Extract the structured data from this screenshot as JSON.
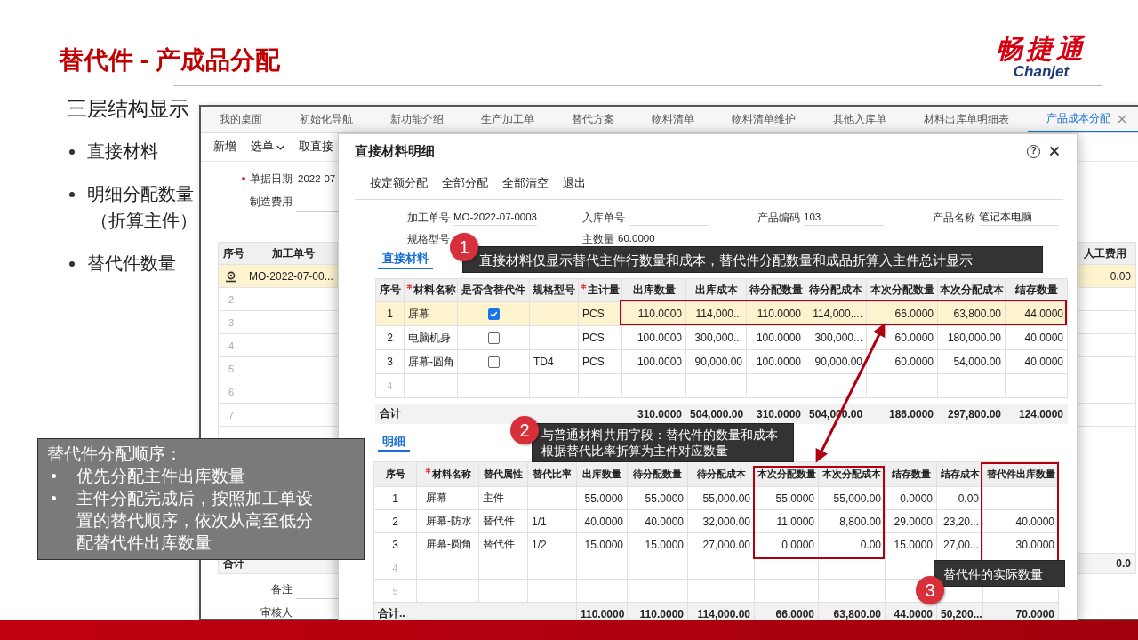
{
  "slide": {
    "title": "替代件 - 产成品分配",
    "logo": {
      "name": "畅捷通",
      "latin": "Chanjet"
    },
    "heading": "三层结构显示",
    "bullets": [
      {
        "lines": [
          "直接材料"
        ]
      },
      {
        "lines": [
          "明细分配数量",
          "（折算主件）"
        ]
      },
      {
        "lines": [
          "替代件数量"
        ]
      }
    ]
  },
  "app": {
    "tabs": [
      {
        "label": "我的桌面",
        "selected": false
      },
      {
        "label": "初始化导航",
        "selected": false
      },
      {
        "label": "新功能介绍",
        "selected": false
      },
      {
        "label": "生产加工单",
        "selected": false
      },
      {
        "label": "替代方案",
        "selected": false
      },
      {
        "label": "物料清单",
        "selected": false
      },
      {
        "label": "物料清单维护",
        "selected": false
      },
      {
        "label": "其他入库单",
        "selected": false
      },
      {
        "label": "材料出库单明细表",
        "selected": false
      },
      {
        "label": "产品成本分配",
        "selected": true
      }
    ],
    "toolbar": [
      {
        "label": "新增",
        "dropdown": false
      },
      {
        "label": "选单",
        "dropdown": true
      },
      {
        "label": "取直接",
        "dropdown": false
      }
    ],
    "form": [
      {
        "label": "单据日期",
        "required": true,
        "value": "2022-07"
      },
      {
        "label": "制造费用",
        "required": false
      }
    ],
    "table": {
      "columns": [
        "序号",
        "加工单号"
      ],
      "last_column": "人工费用",
      "rows": [
        {
          "kind": "current",
          "order": "MO-2022-07-00...",
          "labor": "0.00",
          "selected": true
        },
        {
          "kind": "blank",
          "index": "2",
          "selected": false
        },
        {
          "kind": "blank",
          "index": "3",
          "selected": false
        },
        {
          "kind": "blank",
          "index": "4",
          "selected": false
        },
        {
          "kind": "blank",
          "index": "5",
          "selected": false
        },
        {
          "kind": "blank",
          "index": "6",
          "selected": false
        },
        {
          "kind": "blank",
          "index": "7",
          "selected": false
        }
      ],
      "total": {
        "label": "合计",
        "labor": "0.0"
      }
    },
    "footer_fields": [
      "备注",
      "审核人"
    ]
  },
  "dialog": {
    "title": "直接材料明细",
    "help": "?",
    "toolbar": [
      "按定额分配",
      "全部分配",
      "全部清空",
      "退出"
    ],
    "fields": [
      {
        "label": "加工单号",
        "value": "MO-2022-07-0003"
      },
      {
        "label": "入库单号"
      },
      {
        "label": "产品编码",
        "value": "103"
      },
      {
        "label": "产品名称",
        "value": "笔记本电脑"
      },
      {
        "label": "规格型号"
      },
      {
        "label": "主数量",
        "value": "60.0000"
      }
    ],
    "direct": {
      "tab": {
        "label": "直接材料",
        "selected": true
      },
      "columns": [
        {
          "label": "序号",
          "required": false
        },
        {
          "label": "材料名称",
          "required": true
        },
        {
          "label": "是否含替代件",
          "required": false
        },
        {
          "label": "规格型号",
          "required": false
        },
        {
          "label": "主计量",
          "required": true
        },
        {
          "label": "出库数量",
          "required": false
        },
        {
          "label": "出库成本",
          "required": false
        },
        {
          "label": "待分配数量",
          "required": false
        },
        {
          "label": "待分配成本",
          "required": false
        },
        {
          "label": "本次分配数量",
          "required": false
        },
        {
          "label": "本次分配成本",
          "required": false
        },
        {
          "label": "结存数量",
          "required": false
        }
      ],
      "rows": [
        {
          "index": "1",
          "name": "屏幕",
          "substitute": true,
          "unit": "PCS",
          "cells": [
            "110.0000",
            "114,000...",
            "110.0000",
            "114,000....",
            "66.0000",
            "63,800.00",
            "44.0000"
          ],
          "selected": true
        },
        {
          "index": "2",
          "name": "电脑机身",
          "substitute": false,
          "unit": "PCS",
          "cells": [
            "100.0000",
            "300,000...",
            "100.0000",
            "300,000...",
            "60.0000",
            "180,000.00",
            "40.0000"
          ],
          "selected": false
        },
        {
          "index": "3",
          "name": "屏幕-圆角",
          "substitute": false,
          "spec": "TD4",
          "unit": "PCS",
          "cells": [
            "100.0000",
            "90,000.00",
            "100.0000",
            "90,000.00",
            "60.0000",
            "54,000.00",
            "40.0000"
          ],
          "selected": false
        },
        {
          "index": "4",
          "selected": false
        }
      ],
      "total": {
        "label": "合计",
        "values": [
          "310.0000",
          "504,000.00",
          "310.0000",
          "504,000.00",
          "186.0000",
          "297,800.00",
          "124.0000"
        ]
      }
    },
    "detail": {
      "tab": {
        "label": "明细",
        "selected": true
      },
      "columns": [
        {
          "label": "序号",
          "required": false
        },
        {
          "label": "材料名称",
          "required": true
        },
        {
          "label": "替代属性",
          "required": false
        },
        {
          "label": "替代比率",
          "required": false
        },
        {
          "label": "出库数量",
          "required": false
        },
        {
          "label": "待分配数量",
          "required": false
        },
        {
          "label": "待分配成本",
          "required": false
        },
        {
          "label": "本次分配数量",
          "required": false
        },
        {
          "label": "本次分配成本",
          "required": false
        },
        {
          "label": "结存数量",
          "required": false
        },
        {
          "label": "结存成本",
          "required": false
        },
        {
          "label": "替代件出库数量",
          "required": false
        }
      ],
      "rows": [
        {
          "index": "1",
          "name": "屏幕",
          "attribute": "主件",
          "cells": [
            "55.0000",
            "55.0000",
            "55,000.00",
            "55.0000",
            "55,000.00",
            "0.0000",
            "0.00"
          ]
        },
        {
          "index": "2",
          "name": "屏幕-防水",
          "attribute": "替代件",
          "ratio": "1/1",
          "cells": [
            "40.0000",
            "40.0000",
            "32,000.00",
            "11.0000",
            "8,800.00",
            "29.0000",
            "23,20...",
            "40.0000"
          ]
        },
        {
          "index": "3",
          "name": "屏幕-圆角",
          "attribute": "替代件",
          "ratio": "1/2",
          "cells": [
            "15.0000",
            "15.0000",
            "27,000.00",
            "0.0000",
            "0.00",
            "15.0000",
            "27,00...",
            "30.0000"
          ]
        },
        {
          "index": "4"
        },
        {
          "index": "5"
        }
      ],
      "total": {
        "label": "合计..",
        "values": [
          "110.0000",
          "110.0000",
          "114,000.00",
          "66.0000",
          "63,800.00",
          "44.0000",
          "50,200...",
          "70.0000"
        ]
      }
    }
  },
  "callouts": [
    {
      "number": "1",
      "text": "直接材料仅显示替代主件行数量和成本，替代件分配数量和成品折算入主件总计显示"
    },
    {
      "number": "2",
      "text": "与普通材料共用字段：替代件的数量和成本根据替代比率折算为主件对应数量"
    },
    {
      "number": "3",
      "text": "替代件的实际数量"
    }
  ],
  "note": {
    "title": "替代件分配顺序：",
    "items": [
      "优先分配主件出库数量",
      "主件分配完成后，按照加工单设置的替代顺序，依次从高至低分配替代件出库数量"
    ]
  }
}
